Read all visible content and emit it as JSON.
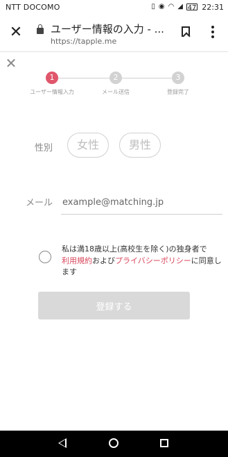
{
  "status_bar": {
    "carrier": "NTT DOCOMO",
    "battery_icon": "battery-icon",
    "battery_level": "47",
    "time": "22:31"
  },
  "browser": {
    "title": "ユーザー情報の入力 - ...",
    "url": "https://tapple.me"
  },
  "steps": [
    {
      "number": "1",
      "label": "ユーザー情報入力",
      "active": true,
      "color": "#e0566b"
    },
    {
      "number": "2",
      "label": "メール送信",
      "active": false,
      "color": "#d2d2d2"
    },
    {
      "number": "3",
      "label": "登録完了",
      "active": false,
      "color": "#d2d2d2"
    }
  ],
  "form": {
    "gender_label": "性別",
    "gender_options": [
      "女性",
      "男性"
    ],
    "email_label": "メール",
    "email_placeholder": "example@matching.jp",
    "agree_prefix": "私は満18歳以上(高校生を除く)の独身者で",
    "terms_link": "利用規約",
    "and_text": "および",
    "privacy_link": "プライバシーポリシー",
    "agree_suffix": "に同意します",
    "submit_label": "登録する"
  },
  "colors": {
    "accent": "#e0566b",
    "link": "#d9475c",
    "disabled_button": "#d9d9d9"
  }
}
